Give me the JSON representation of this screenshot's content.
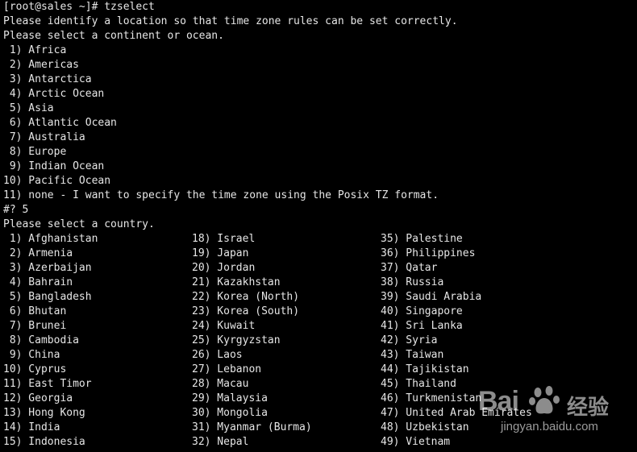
{
  "terminal": {
    "prompt_line": "[root@sales ~]# tzselect",
    "intro1": "Please identify a location so that time zone rules can be set correctly.",
    "intro2": "Please select a continent or ocean.",
    "continents": [
      " 1) Africa",
      " 2) Americas",
      " 3) Antarctica",
      " 4) Arctic Ocean",
      " 5) Asia",
      " 6) Atlantic Ocean",
      " 7) Australia",
      " 8) Europe",
      " 9) Indian Ocean",
      "10) Pacific Ocean",
      "11) none - I want to specify the time zone using the Posix TZ format."
    ],
    "input_line": "#? 5",
    "country_prompt": "Please select a country.",
    "countries_col1": [
      " 1) Afghanistan",
      " 2) Armenia",
      " 3) Azerbaijan",
      " 4) Bahrain",
      " 5) Bangladesh",
      " 6) Bhutan",
      " 7) Brunei",
      " 8) Cambodia",
      " 9) China",
      "10) Cyprus",
      "11) East Timor",
      "12) Georgia",
      "13) Hong Kong",
      "14) India",
      "15) Indonesia"
    ],
    "countries_col2": [
      "18) Israel",
      "19) Japan",
      "20) Jordan",
      "21) Kazakhstan",
      "22) Korea (North)",
      "23) Korea (South)",
      "24) Kuwait",
      "25) Kyrgyzstan",
      "26) Laos",
      "27) Lebanon",
      "28) Macau",
      "29) Malaysia",
      "30) Mongolia",
      "31) Myanmar (Burma)",
      "32) Nepal"
    ],
    "countries_col3": [
      "35) Palestine",
      "36) Philippines",
      "37) Qatar",
      "38) Russia",
      "39) Saudi Arabia",
      "40) Singapore",
      "41) Sri Lanka",
      "42) Syria",
      "43) Taiwan",
      "44) Tajikistan",
      "45) Thailand",
      "46) Turkmenistan",
      "47) United Arab Emirates",
      "48) Uzbekistan",
      "49) Vietnam"
    ]
  },
  "watermark": {
    "logo_text": "Bai",
    "cn_text": "经验",
    "url": "jingyan.baidu.com"
  },
  "colors": {
    "background": "#000000",
    "text": "#e6e6e6"
  }
}
